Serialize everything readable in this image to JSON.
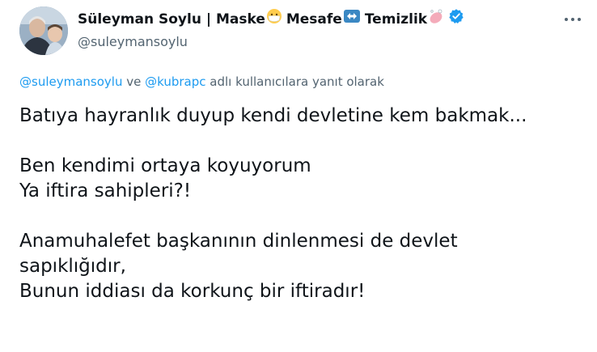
{
  "author": {
    "name": "Süleyman Soylu | Maske",
    "segment_mesafe": "Mesafe",
    "segment_temizlik": "Temizlik",
    "handle": "@suleymansoylu",
    "emoji_mask": "mask-face-emoji",
    "emoji_arrows": "left-right-arrow-emoji",
    "emoji_soap": "soap-emoji",
    "verified_color": "#1d9bf0"
  },
  "reply": {
    "user1": "@suleymansoylu",
    "connector": "ve",
    "user2": "@kubrapc",
    "suffix": "adlı kullanıcılara yanıt olarak"
  },
  "tweet": {
    "lines": [
      "Batıya hayranlık duyup kendi devletine kem bakmak...",
      "",
      "Ben kendimi ortaya koyuyorum",
      "Ya iftira sahipleri?!",
      "",
      "Anamuhalefet başkanının dinlenmesi de devlet",
      "sapıklığıdır,",
      "Bunun iddiası da korkunç bir iftiradır!"
    ]
  },
  "colors": {
    "link": "#1d9bf0",
    "secondary_text": "#536471",
    "primary_text": "#0f1419"
  }
}
